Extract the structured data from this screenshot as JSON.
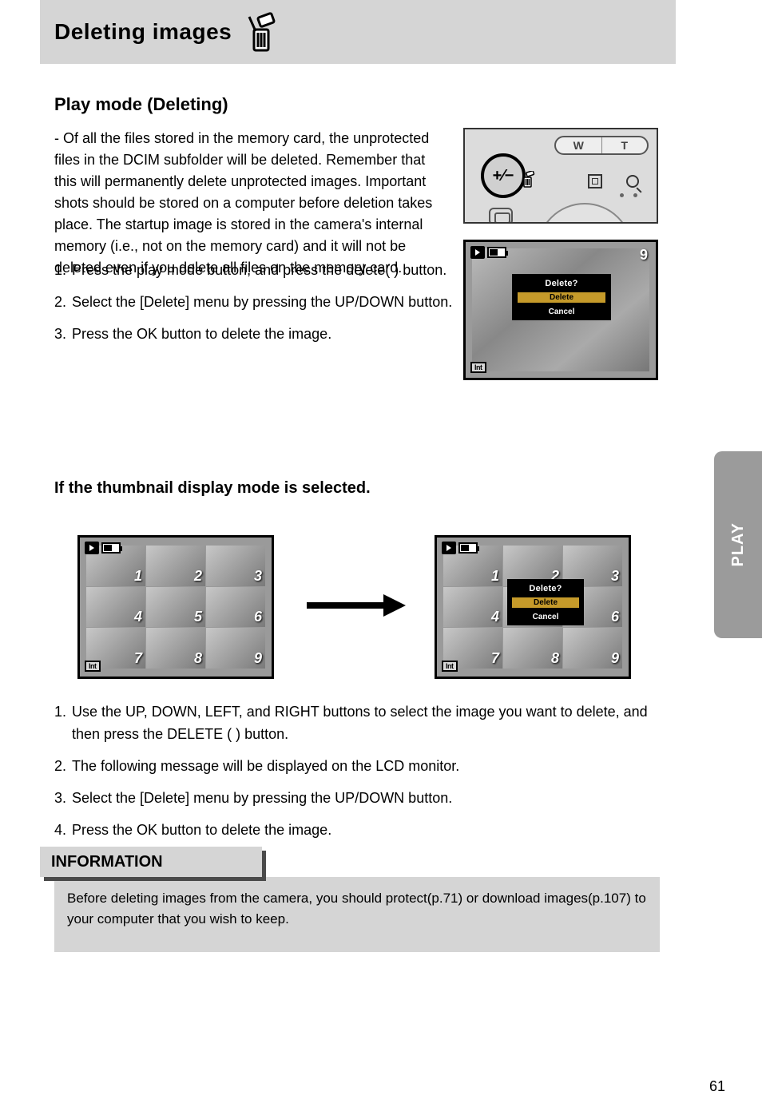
{
  "header": {
    "title": "Deleting images"
  },
  "delete_mode_title": "Play mode (Deleting)",
  "lead_para": {
    "l1": "- Of all the files stored in the memory card, the unprotected files in the DCIM subfolder will be deleted. Remember that this will permanently delete unprotected images. Important shots should be stored on a computer before deletion takes place. The startup image is stored in the camera's internal memory (i.e., not on the memory card) and it will not be deleted even if you delete all files on the memory card."
  },
  "steps": {
    "s1_num": "1.",
    "s1": "Press the play mode button, and press the delete(        ) button.",
    "s2_num": "2.",
    "s2": "Select the [Delete] menu by pressing the UP/DOWN button.",
    "s3_num": "3.",
    "s3": "Press the OK button to delete the image."
  },
  "subsection_title": "If the thumbnail display mode is selected.",
  "after_steps": {
    "a1_num": "1.",
    "a1": "Use the UP, DOWN, LEFT, and RIGHT buttons to select the image you want to delete, and then press the DELETE (       ) button.",
    "a2_num": "2.",
    "a2": "The following message will be displayed on the LCD monitor.",
    "a3_num": "3.",
    "a3": "Select the [Delete] menu by pressing the UP/DOWN button.",
    "a4_num": "4.",
    "a4": "Press the OK button to delete the image."
  },
  "dialog": {
    "prompt": "Delete?",
    "opt_delete": "Delete",
    "opt_cancel": "Cancel"
  },
  "lcd": {
    "counter": "9",
    "int_label": "Int",
    "thumbs": [
      "1",
      "2",
      "3",
      "4",
      "5",
      "6",
      "7",
      "8",
      "9"
    ]
  },
  "camera_controls": {
    "zoom_wide": "W",
    "zoom_tele": "T",
    "main_glyph": "+⁄−"
  },
  "info": {
    "tag": "INFORMATION",
    "text": "Before deleting images from the camera, you should protect(p.71) or download images(p.107) to your computer that you wish to keep."
  },
  "side_tab": "PLAY",
  "page_number": "61"
}
